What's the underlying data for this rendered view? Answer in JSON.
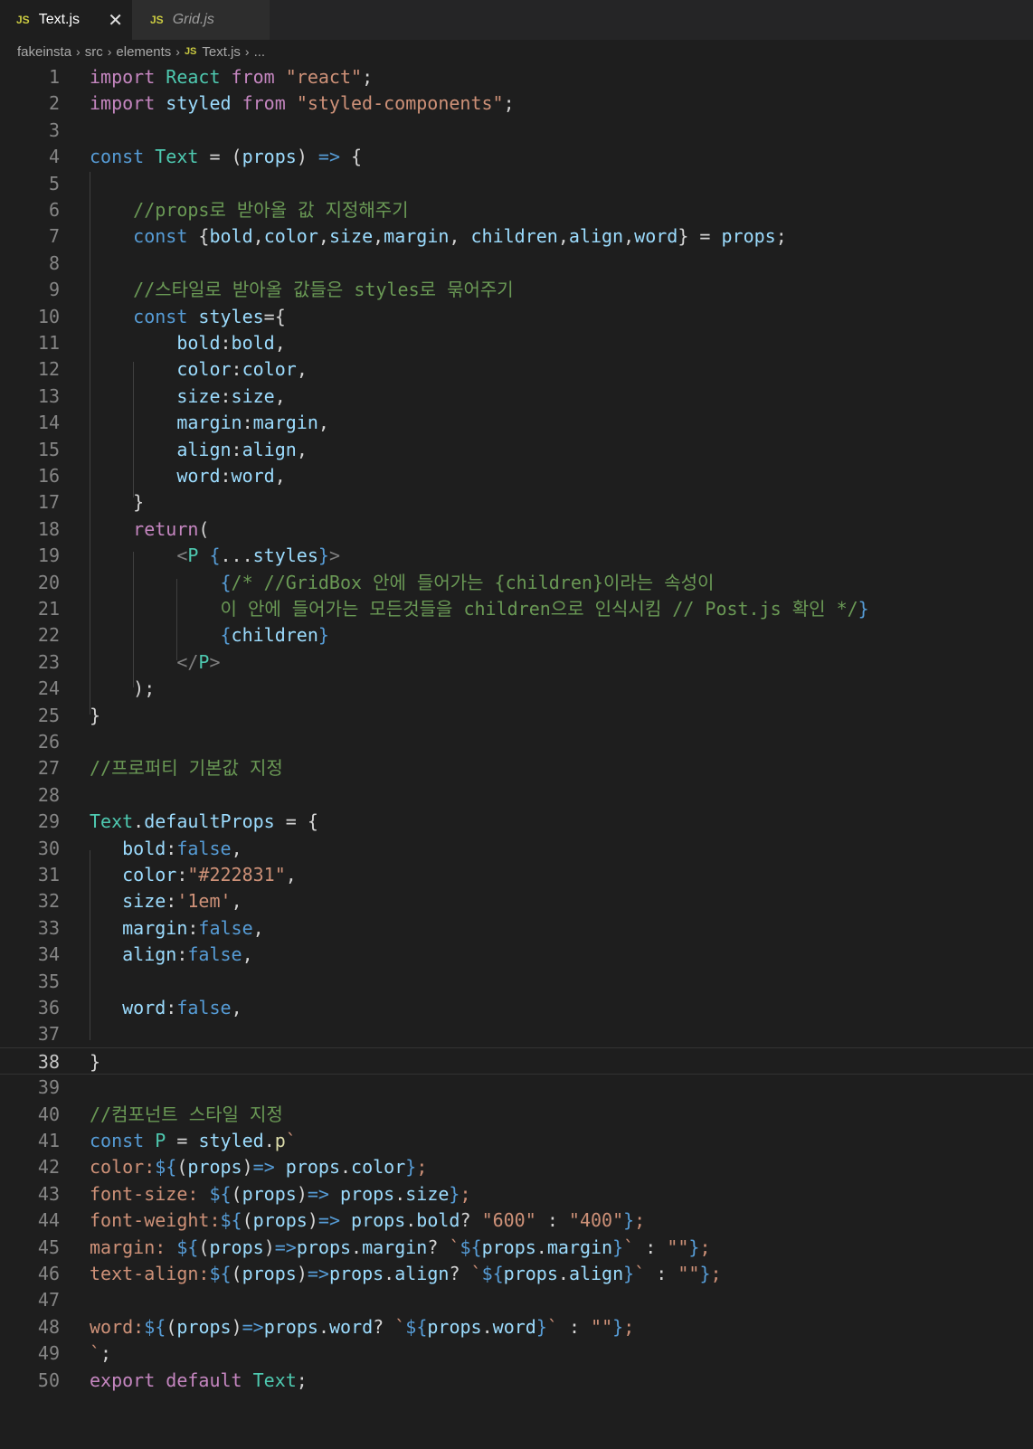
{
  "tabs": [
    {
      "icon": "JS",
      "label": "Text.js",
      "active": true
    },
    {
      "icon": "JS",
      "label": "Grid.js",
      "active": false
    }
  ],
  "breadcrumb": [
    "fakeinsta",
    "src",
    "elements",
    "Text.js",
    "..."
  ],
  "breadcrumb_file_icon": "JS",
  "current_line": 38,
  "colors": {
    "keyword": "#c586c0",
    "storage": "#569cd6",
    "variable": "#9cdcfe",
    "class": "#4ec9b0",
    "string": "#ce9178",
    "comment": "#6a9955",
    "plain": "#d4d4d4",
    "line_number": "#858585",
    "background": "#1e1e1e"
  },
  "code_lines": [
    [
      [
        "kw",
        "import "
      ],
      [
        "cls",
        "React "
      ],
      [
        "kw",
        "from "
      ],
      [
        "str",
        "\"react\""
      ],
      [
        "pun",
        ";"
      ]
    ],
    [
      [
        "kw",
        "import "
      ],
      [
        "var",
        "styled "
      ],
      [
        "kw",
        "from "
      ],
      [
        "str",
        "\"styled-components\""
      ],
      [
        "pun",
        ";"
      ]
    ],
    [],
    [
      [
        "st",
        "const "
      ],
      [
        "cls",
        "Text "
      ],
      [
        "pun",
        "= ("
      ],
      [
        "var",
        "props"
      ],
      [
        "pun",
        ") "
      ],
      [
        "st",
        "=> "
      ],
      [
        "pun",
        "{"
      ]
    ],
    [],
    [
      [
        "pun",
        "    "
      ],
      [
        "cmt",
        "//props로 받아올 값 지정해주기"
      ]
    ],
    [
      [
        "pun",
        "    "
      ],
      [
        "st",
        "const "
      ],
      [
        "pun",
        "{"
      ],
      [
        "var",
        "bold"
      ],
      [
        "pun",
        ","
      ],
      [
        "var",
        "color"
      ],
      [
        "pun",
        ","
      ],
      [
        "var",
        "size"
      ],
      [
        "pun",
        ","
      ],
      [
        "var",
        "margin"
      ],
      [
        "pun",
        ", "
      ],
      [
        "var",
        "children"
      ],
      [
        "pun",
        ","
      ],
      [
        "var",
        "align"
      ],
      [
        "pun",
        ","
      ],
      [
        "var",
        "word"
      ],
      [
        "pun",
        "} = "
      ],
      [
        "var",
        "props"
      ],
      [
        "pun",
        ";"
      ]
    ],
    [],
    [
      [
        "pun",
        "    "
      ],
      [
        "cmt",
        "//스타일로 받아올 값들은 styles로 묶어주기"
      ]
    ],
    [
      [
        "pun",
        "    "
      ],
      [
        "st",
        "const "
      ],
      [
        "var",
        "styles"
      ],
      [
        "pun",
        "={"
      ]
    ],
    [
      [
        "pun",
        "        "
      ],
      [
        "var",
        "bold"
      ],
      [
        "pun",
        ":"
      ],
      [
        "var",
        "bold"
      ],
      [
        "pun",
        ","
      ]
    ],
    [
      [
        "pun",
        "        "
      ],
      [
        "var",
        "color"
      ],
      [
        "pun",
        ":"
      ],
      [
        "var",
        "color"
      ],
      [
        "pun",
        ","
      ]
    ],
    [
      [
        "pun",
        "        "
      ],
      [
        "var",
        "size"
      ],
      [
        "pun",
        ":"
      ],
      [
        "var",
        "size"
      ],
      [
        "pun",
        ","
      ]
    ],
    [
      [
        "pun",
        "        "
      ],
      [
        "var",
        "margin"
      ],
      [
        "pun",
        ":"
      ],
      [
        "var",
        "margin"
      ],
      [
        "pun",
        ","
      ]
    ],
    [
      [
        "pun",
        "        "
      ],
      [
        "var",
        "align"
      ],
      [
        "pun",
        ":"
      ],
      [
        "var",
        "align"
      ],
      [
        "pun",
        ","
      ]
    ],
    [
      [
        "pun",
        "        "
      ],
      [
        "var",
        "word"
      ],
      [
        "pun",
        ":"
      ],
      [
        "var",
        "word"
      ],
      [
        "pun",
        ","
      ]
    ],
    [
      [
        "pun",
        "    }"
      ]
    ],
    [
      [
        "pun",
        "    "
      ],
      [
        "kw",
        "return"
      ],
      [
        "pun",
        "("
      ]
    ],
    [
      [
        "pun",
        "        "
      ],
      [
        "tag",
        "<"
      ],
      [
        "cls",
        "P "
      ],
      [
        "st",
        "{"
      ],
      [
        "pun",
        "..."
      ],
      [
        "var",
        "styles"
      ],
      [
        "st",
        "}"
      ],
      [
        "tag",
        ">"
      ]
    ],
    [
      [
        "pun",
        "            "
      ],
      [
        "st",
        "{"
      ],
      [
        "cmt",
        "/* //GridBox 안에 들어가는 {children}이라는 속성이"
      ]
    ],
    [
      [
        "pun",
        "            "
      ],
      [
        "cmt",
        "이 안에 들어가는 모든것들을 children으로 인식시킴 // Post.js 확인 */"
      ],
      [
        "st",
        "}"
      ]
    ],
    [
      [
        "pun",
        "            "
      ],
      [
        "st",
        "{"
      ],
      [
        "var",
        "children"
      ],
      [
        "st",
        "}"
      ]
    ],
    [
      [
        "pun",
        "        "
      ],
      [
        "tag",
        "</"
      ],
      [
        "cls",
        "P"
      ],
      [
        "tag",
        ">"
      ]
    ],
    [
      [
        "pun",
        "    );"
      ]
    ],
    [
      [
        "pun",
        "}"
      ]
    ],
    [],
    [
      [
        "cmt",
        "//프로퍼티 기본값 지정"
      ]
    ],
    [],
    [
      [
        "cls",
        "Text"
      ],
      [
        "pun",
        "."
      ],
      [
        "var",
        "defaultProps"
      ],
      [
        "pun",
        " = {"
      ]
    ],
    [
      [
        "pun",
        "   "
      ],
      [
        "var",
        "bold"
      ],
      [
        "pun",
        ":"
      ],
      [
        "bool",
        "false"
      ],
      [
        "pun",
        ","
      ]
    ],
    [
      [
        "pun",
        "   "
      ],
      [
        "var",
        "color"
      ],
      [
        "pun",
        ":"
      ],
      [
        "str",
        "\"#222831\""
      ],
      [
        "pun",
        ","
      ]
    ],
    [
      [
        "pun",
        "   "
      ],
      [
        "var",
        "size"
      ],
      [
        "pun",
        ":"
      ],
      [
        "str",
        "'1em'"
      ],
      [
        "pun",
        ","
      ]
    ],
    [
      [
        "pun",
        "   "
      ],
      [
        "var",
        "margin"
      ],
      [
        "pun",
        ":"
      ],
      [
        "bool",
        "false"
      ],
      [
        "pun",
        ","
      ]
    ],
    [
      [
        "pun",
        "   "
      ],
      [
        "var",
        "align"
      ],
      [
        "pun",
        ":"
      ],
      [
        "bool",
        "false"
      ],
      [
        "pun",
        ","
      ]
    ],
    [],
    [
      [
        "pun",
        "   "
      ],
      [
        "var",
        "word"
      ],
      [
        "pun",
        ":"
      ],
      [
        "bool",
        "false"
      ],
      [
        "pun",
        ","
      ]
    ],
    [],
    [
      [
        "pun",
        "}"
      ]
    ],
    [],
    [
      [
        "cmt",
        "//컴포넌트 스타일 지정"
      ]
    ],
    [
      [
        "st",
        "const "
      ],
      [
        "cls",
        "P "
      ],
      [
        "pun",
        "= "
      ],
      [
        "var",
        "styled"
      ],
      [
        "pun",
        "."
      ],
      [
        "fn",
        "p"
      ],
      [
        "str",
        "`"
      ]
    ],
    [
      [
        "str",
        "color:"
      ],
      [
        "st",
        "${"
      ],
      [
        "pun",
        "("
      ],
      [
        "var",
        "props"
      ],
      [
        "pun",
        ")"
      ],
      [
        "st",
        "=> "
      ],
      [
        "var",
        "props"
      ],
      [
        "pun",
        "."
      ],
      [
        "var",
        "color"
      ],
      [
        "st",
        "}"
      ],
      [
        "str",
        ";"
      ]
    ],
    [
      [
        "str",
        "font-size: "
      ],
      [
        "st",
        "${"
      ],
      [
        "pun",
        "("
      ],
      [
        "var",
        "props"
      ],
      [
        "pun",
        ")"
      ],
      [
        "st",
        "=> "
      ],
      [
        "var",
        "props"
      ],
      [
        "pun",
        "."
      ],
      [
        "var",
        "size"
      ],
      [
        "st",
        "}"
      ],
      [
        "str",
        ";"
      ]
    ],
    [
      [
        "str",
        "font-weight:"
      ],
      [
        "st",
        "${"
      ],
      [
        "pun",
        "("
      ],
      [
        "var",
        "props"
      ],
      [
        "pun",
        ")"
      ],
      [
        "st",
        "=> "
      ],
      [
        "var",
        "props"
      ],
      [
        "pun",
        "."
      ],
      [
        "var",
        "bold"
      ],
      [
        "pun",
        "? "
      ],
      [
        "str",
        "\"600\""
      ],
      [
        "pun",
        " : "
      ],
      [
        "str",
        "\"400\""
      ],
      [
        "st",
        "}"
      ],
      [
        "str",
        ";"
      ]
    ],
    [
      [
        "str",
        "margin: "
      ],
      [
        "st",
        "${"
      ],
      [
        "pun",
        "("
      ],
      [
        "var",
        "props"
      ],
      [
        "pun",
        ")"
      ],
      [
        "st",
        "=>"
      ],
      [
        "var",
        "props"
      ],
      [
        "pun",
        "."
      ],
      [
        "var",
        "margin"
      ],
      [
        "pun",
        "? "
      ],
      [
        "str",
        "`"
      ],
      [
        "st",
        "${"
      ],
      [
        "var",
        "props"
      ],
      [
        "pun",
        "."
      ],
      [
        "var",
        "margin"
      ],
      [
        "st",
        "}"
      ],
      [
        "str",
        "`"
      ],
      [
        "pun",
        " : "
      ],
      [
        "str",
        "\"\""
      ],
      [
        "st",
        "}"
      ],
      [
        "str",
        ";"
      ]
    ],
    [
      [
        "str",
        "text-align:"
      ],
      [
        "st",
        "${"
      ],
      [
        "pun",
        "("
      ],
      [
        "var",
        "props"
      ],
      [
        "pun",
        ")"
      ],
      [
        "st",
        "=>"
      ],
      [
        "var",
        "props"
      ],
      [
        "pun",
        "."
      ],
      [
        "var",
        "align"
      ],
      [
        "pun",
        "? "
      ],
      [
        "str",
        "`"
      ],
      [
        "st",
        "${"
      ],
      [
        "var",
        "props"
      ],
      [
        "pun",
        "."
      ],
      [
        "var",
        "align"
      ],
      [
        "st",
        "}"
      ],
      [
        "str",
        "`"
      ],
      [
        "pun",
        " : "
      ],
      [
        "str",
        "\"\""
      ],
      [
        "st",
        "}"
      ],
      [
        "str",
        ";"
      ]
    ],
    [],
    [
      [
        "str",
        "word:"
      ],
      [
        "st",
        "${"
      ],
      [
        "pun",
        "("
      ],
      [
        "var",
        "props"
      ],
      [
        "pun",
        ")"
      ],
      [
        "st",
        "=>"
      ],
      [
        "var",
        "props"
      ],
      [
        "pun",
        "."
      ],
      [
        "var",
        "word"
      ],
      [
        "pun",
        "? "
      ],
      [
        "str",
        "`"
      ],
      [
        "st",
        "${"
      ],
      [
        "var",
        "props"
      ],
      [
        "pun",
        "."
      ],
      [
        "var",
        "word"
      ],
      [
        "st",
        "}"
      ],
      [
        "str",
        "`"
      ],
      [
        "pun",
        " : "
      ],
      [
        "str",
        "\"\""
      ],
      [
        "st",
        "}"
      ],
      [
        "str",
        ";"
      ]
    ],
    [
      [
        "str",
        "`"
      ],
      [
        "pun",
        ";"
      ]
    ],
    [
      [
        "kw",
        "export "
      ],
      [
        "kw",
        "default "
      ],
      [
        "cls",
        "Text"
      ],
      [
        "pun",
        ";"
      ]
    ]
  ]
}
